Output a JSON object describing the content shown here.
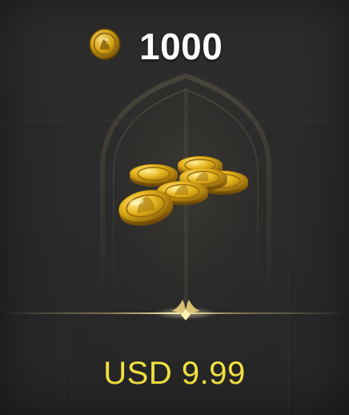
{
  "offer": {
    "currency_icon": "gold-coin-icon",
    "amount": "1000",
    "product_icon": "gold-coin-pile-icon",
    "price": "USD 9.99"
  },
  "colors": {
    "background": "#2a2a2b",
    "amount_text": "#ffffff",
    "price_text": "#f3e440",
    "gold": "#d9a514",
    "divider_glow": "#f0d98a"
  }
}
